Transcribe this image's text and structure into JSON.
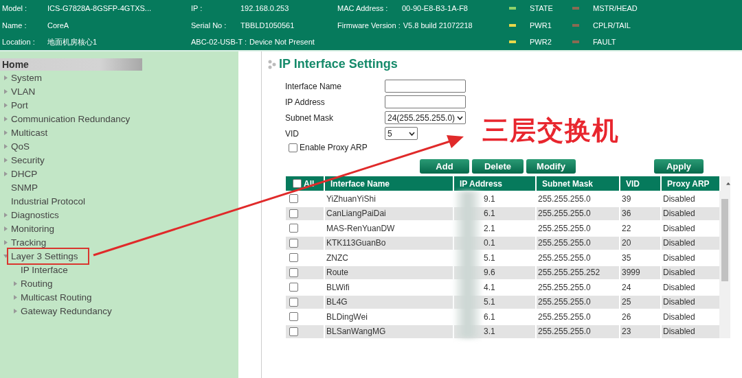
{
  "header": {
    "fields": [
      {
        "label": "Model :",
        "value": "ICS-G7828A-8GSFP-4GTXS..."
      },
      {
        "label": "IP :",
        "value": "192.168.0.253"
      },
      {
        "label": "MAC Address :",
        "value": "00-90-E8-B3-1A-F8"
      },
      {
        "label": "Name :",
        "value": "CoreA"
      },
      {
        "label": "Serial No :",
        "value": "TBBLD1050561"
      },
      {
        "label": "Firmware Version :",
        "value": "V5.8 build 21072218"
      },
      {
        "label": "Location :",
        "value": "地面机房核心1"
      },
      {
        "label": "ABC-02-USB-T :",
        "value": "Device Not Present"
      }
    ],
    "leds": [
      {
        "label": "STATE",
        "color": "#8fd16a"
      },
      {
        "label": "MSTR/HEAD",
        "color": "#8a6a52"
      },
      {
        "label": "PWR1",
        "color": "#e8d84a"
      },
      {
        "label": "CPLR/TAIL",
        "color": "#8a6a52"
      },
      {
        "label": "PWR2",
        "color": "#e8d84a"
      },
      {
        "label": "FAULT",
        "color": "#8a6a52"
      }
    ]
  },
  "sidebar": {
    "home": "Home",
    "items": [
      {
        "label": "System",
        "expandable": true
      },
      {
        "label": "VLAN",
        "expandable": true
      },
      {
        "label": "Port",
        "expandable": true
      },
      {
        "label": "Communication Redundancy",
        "expandable": true
      },
      {
        "label": "Multicast",
        "expandable": true
      },
      {
        "label": "QoS",
        "expandable": true
      },
      {
        "label": "Security",
        "expandable": true
      },
      {
        "label": "DHCP",
        "expandable": true
      },
      {
        "label": "SNMP",
        "expandable": false
      },
      {
        "label": "Industrial Protocol",
        "expandable": false
      },
      {
        "label": "Diagnostics",
        "expandable": true
      },
      {
        "label": "Monitoring",
        "expandable": true
      },
      {
        "label": "Tracking",
        "expandable": true
      },
      {
        "label": "Layer 3 Settings",
        "expandable": true,
        "expanded": true,
        "highlighted": true,
        "children": [
          {
            "label": "IP Interface",
            "expandable": false
          },
          {
            "label": "Routing",
            "expandable": true
          },
          {
            "label": "Multicast Routing",
            "expandable": true
          },
          {
            "label": "Gateway Redundancy",
            "expandable": true
          }
        ]
      }
    ]
  },
  "page": {
    "title": "IP Interface Settings",
    "form": [
      {
        "kind": "text",
        "label": "Interface Name"
      },
      {
        "kind": "text",
        "label": "IP Address"
      },
      {
        "kind": "select",
        "label": "Subnet Mask",
        "value": "24(255.255.255.0)",
        "wide": true
      },
      {
        "kind": "select",
        "label": "VID",
        "value": "5",
        "wide": false
      }
    ],
    "proxy_arp": {
      "label": "Enable Proxy ARP",
      "checked": false
    },
    "buttons": [
      "Add",
      "Delete",
      "Modify"
    ],
    "apply": "Apply",
    "annotation": "三层交换机",
    "table": {
      "columns": [
        "All",
        "Interface Name",
        "IP Address",
        "Subnet Mask",
        "VID",
        "Proxy ARP"
      ],
      "all_checked": false,
      "rows": [
        {
          "checked": false,
          "name": "YiZhuanYiShi",
          "ip": "9.1",
          "mask": "255.255.255.0",
          "vid": "39",
          "proxy": "Disabled"
        },
        {
          "checked": false,
          "name": "CanLiangPaiDai",
          "ip": "6.1",
          "mask": "255.255.255.0",
          "vid": "36",
          "proxy": "Disabled"
        },
        {
          "checked": false,
          "name": "MAS-RenYuanDW",
          "ip": "2.1",
          "mask": "255.255.255.0",
          "vid": "22",
          "proxy": "Disabled"
        },
        {
          "checked": false,
          "name": "KTK113GuanBo",
          "ip": "0.1",
          "mask": "255.255.255.0",
          "vid": "20",
          "proxy": "Disabled"
        },
        {
          "checked": false,
          "name": "ZNZC",
          "ip": "5.1",
          "mask": "255.255.255.0",
          "vid": "35",
          "proxy": "Disabled"
        },
        {
          "checked": false,
          "name": "Route",
          "ip": "9.6",
          "mask": "255.255.255.252",
          "vid": "3999",
          "proxy": "Disabled"
        },
        {
          "checked": false,
          "name": "BLWifi",
          "ip": "4.1",
          "mask": "255.255.255.0",
          "vid": "24",
          "proxy": "Disabled"
        },
        {
          "checked": false,
          "name": "BL4G",
          "ip": "5.1",
          "mask": "255.255.255.0",
          "vid": "25",
          "proxy": "Disabled"
        },
        {
          "checked": false,
          "name": "BLDingWei",
          "ip": "6.1",
          "mask": "255.255.255.0",
          "vid": "26",
          "proxy": "Disabled"
        },
        {
          "checked": false,
          "name": "BLSanWangMG",
          "ip": "3.1",
          "mask": "255.255.255.0",
          "vid": "23",
          "proxy": "Disabled"
        }
      ]
    }
  }
}
